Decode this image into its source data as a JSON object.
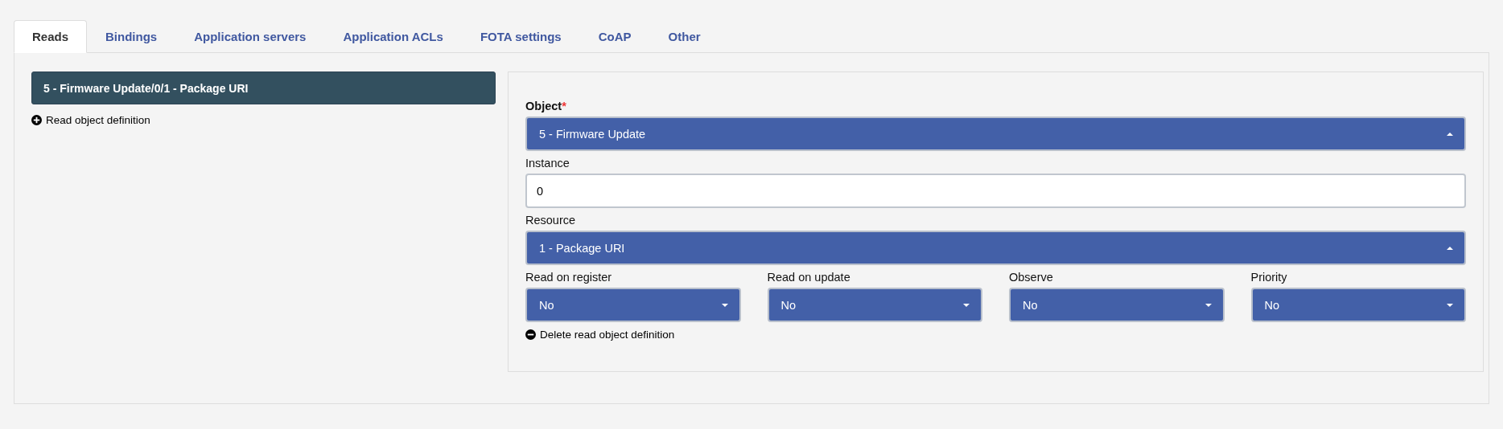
{
  "tabs": [
    {
      "label": "Reads",
      "selected": true
    },
    {
      "label": "Bindings",
      "selected": false
    },
    {
      "label": "Application servers",
      "selected": false
    },
    {
      "label": "Application ACLs",
      "selected": false
    },
    {
      "label": "FOTA settings",
      "selected": false
    },
    {
      "label": "CoAP",
      "selected": false
    },
    {
      "label": "Other",
      "selected": false
    }
  ],
  "read_list": {
    "items": [
      {
        "label": "5 - Firmware Update/0/1 - Package URI",
        "selected": true
      }
    ],
    "add_link": "Read object definition"
  },
  "form": {
    "object": {
      "label": "Object",
      "required_mark": "*",
      "value": "5 - Firmware Update",
      "expanded": true
    },
    "instance": {
      "label": "Instance",
      "value": "0"
    },
    "resource": {
      "label": "Resource",
      "value": "1 - Package URI",
      "expanded": true
    },
    "options": [
      {
        "label": "Read on register",
        "value": "No",
        "expanded": false
      },
      {
        "label": "Read on update",
        "value": "No",
        "expanded": false
      },
      {
        "label": "Observe",
        "value": "No",
        "expanded": false
      },
      {
        "label": "Priority",
        "value": "No",
        "expanded": false
      }
    ],
    "delete_link": "Delete read object definition"
  }
}
